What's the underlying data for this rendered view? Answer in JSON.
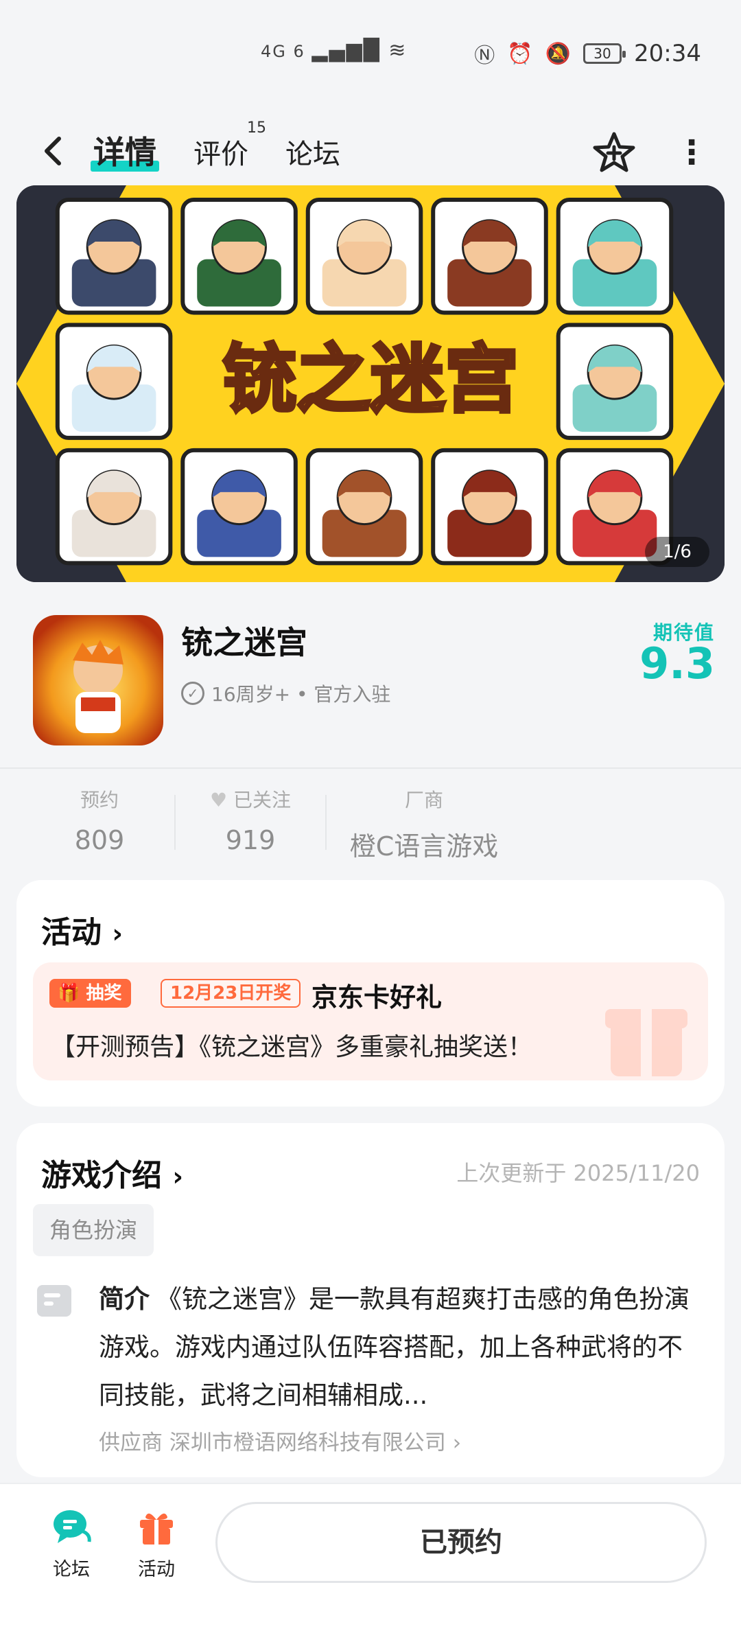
{
  "status_bar": {
    "network": "4G 6",
    "battery": "30",
    "time": "20:34"
  },
  "header": {
    "tabs": [
      {
        "label": "详情",
        "active": true
      },
      {
        "label": "评价",
        "count": "15"
      },
      {
        "label": "论坛"
      }
    ]
  },
  "banner": {
    "title": "铳之迷宫",
    "pager": "1/6"
  },
  "game": {
    "name": "铳之迷宫",
    "meta": "16周岁+ • 官方入驻",
    "expect_label": "期待值",
    "expect_value": "9.3"
  },
  "stats": [
    {
      "label": "预约",
      "value": "809"
    },
    {
      "label": "已关注",
      "value": "919"
    },
    {
      "label": "厂商",
      "value": "橙C语言游戏"
    }
  ],
  "activity": {
    "title": "活动",
    "badge": "抽奖",
    "date_badge": "12月23日开奖",
    "promo_title": "京东卡好礼",
    "promo_desc": "【开测预告】《铳之迷宫》多重豪礼抽奖送！"
  },
  "intro": {
    "title": "游戏介绍",
    "updated": "上次更新于 2025/11/20",
    "tag": "角色扮演",
    "label": "简介",
    "text": "《铳之迷宫》是一款具有超爽打击感的角色扮演游戏。游戏内通过队伍阵容搭配，加上各种武将的不同技能，武将之间相辅相成...",
    "supplier": "供应商 深圳市橙语网络科技有限公司"
  },
  "bottom_bar": {
    "forum_label": "论坛",
    "activity_label": "活动",
    "reserve_label": "已预约"
  },
  "colors": {
    "accent": "#14c3b6",
    "promo": "#ff6a3d",
    "banner_yellow": "#ffd21f"
  }
}
